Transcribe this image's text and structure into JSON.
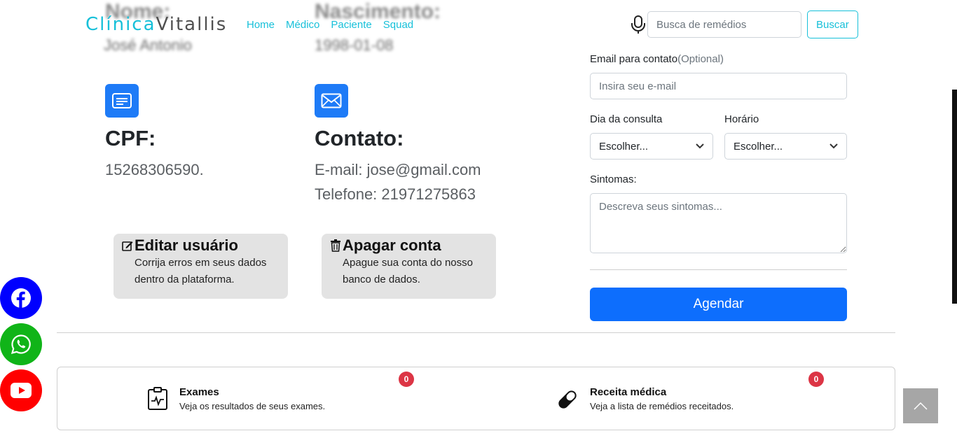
{
  "header": {
    "brand_part1": "Clínica",
    "brand_part2": "Vitallis",
    "nav": [
      "Home",
      "Médico",
      "Paciente",
      "Squad"
    ],
    "search_placeholder": "Busca de remédios",
    "search_button": "Buscar"
  },
  "behind": {
    "nome_label": "Nome:",
    "nome_value": "José Antonio",
    "nasc_label": "Nascimento:",
    "nasc_value": "1998-01-08"
  },
  "profile": {
    "cpf_title": "CPF:",
    "cpf_value": "15268306590.",
    "contato_title": "Contato:",
    "email_line": "E-mail: jose@gmail.com",
    "phone_line": "Telefone: 21971275863"
  },
  "actions": {
    "edit_title": "Editar usuário",
    "edit_desc_1": "Corrija erros em seus dados",
    "edit_desc_2": "dentro da plataforma.",
    "delete_title": "Apagar conta",
    "delete_desc_1": "Apague sua conta do nosso",
    "delete_desc_2": "banco de dados."
  },
  "form": {
    "email_label": "Email para contato",
    "email_optional": "(Optional)",
    "email_placeholder": "Insira seu e-mail",
    "day_label": "Dia da consulta",
    "day_value": "Escolher...",
    "time_label": "Horário",
    "time_value": "Escolher...",
    "symptoms_label": "Sintomas:",
    "symptoms_placeholder": "Descreva seus sintomas...",
    "submit": "Agendar"
  },
  "panel": {
    "exams_title": "Exames",
    "exams_desc": "Veja os resultados de seus exames.",
    "exams_count": "0",
    "recipe_title": "Receita médica",
    "recipe_desc": "Veja a lista de remédios receitados.",
    "recipe_count": "0"
  },
  "colors": {
    "accent": "#17c0d9",
    "primary": "#0d6efd",
    "facebook": "#0000ff",
    "whatsapp": "#10b418",
    "youtube": "#ff0000",
    "badge": "#dc3545"
  }
}
